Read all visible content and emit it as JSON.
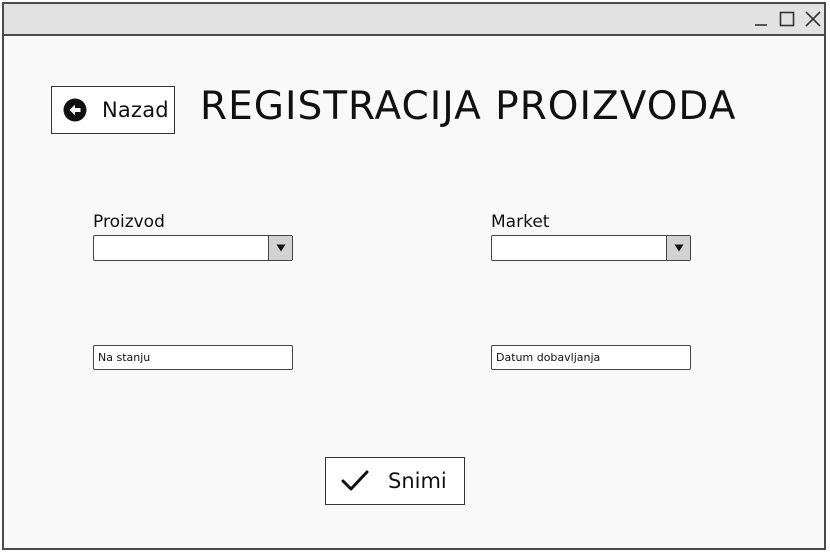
{
  "header": {
    "back_label": "Nazad",
    "title": "REGISTRACIJA PROIZVODA"
  },
  "form": {
    "product": {
      "label": "Proizvod",
      "value": ""
    },
    "market": {
      "label": "Market",
      "value": ""
    },
    "stock": {
      "placeholder": "Na stanju",
      "value": ""
    },
    "delivery_date": {
      "placeholder": "Datum dobavljanja",
      "value": ""
    }
  },
  "actions": {
    "save_label": "Snimi"
  },
  "icons": {
    "back": "arrow-left-circle-icon",
    "save": "checkmark-icon",
    "dropdown": "triangle-down-icon",
    "minimize": "minimize-icon",
    "maximize": "maximize-icon",
    "close": "close-icon"
  },
  "colors": {
    "background": "#f9f9f9",
    "titlebar": "#e2e2e2",
    "border": "#4a4a4a",
    "dropdown_button": "#d2d2d2"
  }
}
